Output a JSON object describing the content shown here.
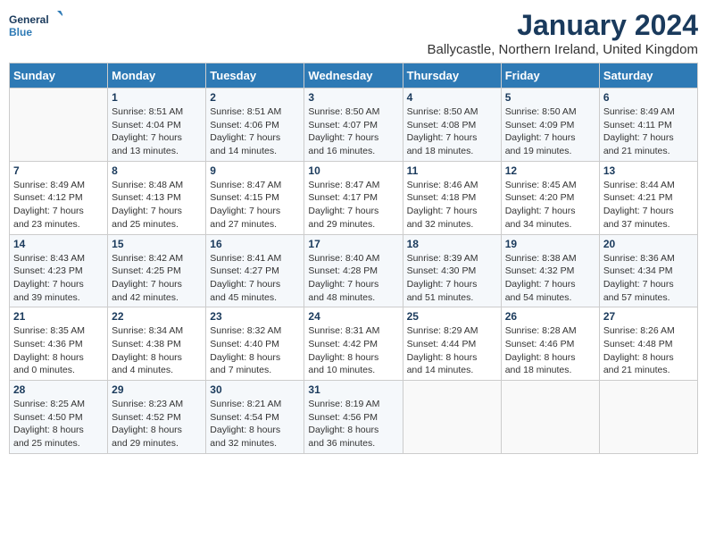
{
  "header": {
    "logo_line1": "General",
    "logo_line2": "Blue",
    "title": "January 2024",
    "subtitle": "Ballycastle, Northern Ireland, United Kingdom"
  },
  "calendar": {
    "days_of_week": [
      "Sunday",
      "Monday",
      "Tuesday",
      "Wednesday",
      "Thursday",
      "Friday",
      "Saturday"
    ],
    "weeks": [
      [
        {
          "day": "",
          "info": ""
        },
        {
          "day": "1",
          "info": "Sunrise: 8:51 AM\nSunset: 4:04 PM\nDaylight: 7 hours\nand 13 minutes."
        },
        {
          "day": "2",
          "info": "Sunrise: 8:51 AM\nSunset: 4:06 PM\nDaylight: 7 hours\nand 14 minutes."
        },
        {
          "day": "3",
          "info": "Sunrise: 8:50 AM\nSunset: 4:07 PM\nDaylight: 7 hours\nand 16 minutes."
        },
        {
          "day": "4",
          "info": "Sunrise: 8:50 AM\nSunset: 4:08 PM\nDaylight: 7 hours\nand 18 minutes."
        },
        {
          "day": "5",
          "info": "Sunrise: 8:50 AM\nSunset: 4:09 PM\nDaylight: 7 hours\nand 19 minutes."
        },
        {
          "day": "6",
          "info": "Sunrise: 8:49 AM\nSunset: 4:11 PM\nDaylight: 7 hours\nand 21 minutes."
        }
      ],
      [
        {
          "day": "7",
          "info": "Sunrise: 8:49 AM\nSunset: 4:12 PM\nDaylight: 7 hours\nand 23 minutes."
        },
        {
          "day": "8",
          "info": "Sunrise: 8:48 AM\nSunset: 4:13 PM\nDaylight: 7 hours\nand 25 minutes."
        },
        {
          "day": "9",
          "info": "Sunrise: 8:47 AM\nSunset: 4:15 PM\nDaylight: 7 hours\nand 27 minutes."
        },
        {
          "day": "10",
          "info": "Sunrise: 8:47 AM\nSunset: 4:17 PM\nDaylight: 7 hours\nand 29 minutes."
        },
        {
          "day": "11",
          "info": "Sunrise: 8:46 AM\nSunset: 4:18 PM\nDaylight: 7 hours\nand 32 minutes."
        },
        {
          "day": "12",
          "info": "Sunrise: 8:45 AM\nSunset: 4:20 PM\nDaylight: 7 hours\nand 34 minutes."
        },
        {
          "day": "13",
          "info": "Sunrise: 8:44 AM\nSunset: 4:21 PM\nDaylight: 7 hours\nand 37 minutes."
        }
      ],
      [
        {
          "day": "14",
          "info": "Sunrise: 8:43 AM\nSunset: 4:23 PM\nDaylight: 7 hours\nand 39 minutes."
        },
        {
          "day": "15",
          "info": "Sunrise: 8:42 AM\nSunset: 4:25 PM\nDaylight: 7 hours\nand 42 minutes."
        },
        {
          "day": "16",
          "info": "Sunrise: 8:41 AM\nSunset: 4:27 PM\nDaylight: 7 hours\nand 45 minutes."
        },
        {
          "day": "17",
          "info": "Sunrise: 8:40 AM\nSunset: 4:28 PM\nDaylight: 7 hours\nand 48 minutes."
        },
        {
          "day": "18",
          "info": "Sunrise: 8:39 AM\nSunset: 4:30 PM\nDaylight: 7 hours\nand 51 minutes."
        },
        {
          "day": "19",
          "info": "Sunrise: 8:38 AM\nSunset: 4:32 PM\nDaylight: 7 hours\nand 54 minutes."
        },
        {
          "day": "20",
          "info": "Sunrise: 8:36 AM\nSunset: 4:34 PM\nDaylight: 7 hours\nand 57 minutes."
        }
      ],
      [
        {
          "day": "21",
          "info": "Sunrise: 8:35 AM\nSunset: 4:36 PM\nDaylight: 8 hours\nand 0 minutes."
        },
        {
          "day": "22",
          "info": "Sunrise: 8:34 AM\nSunset: 4:38 PM\nDaylight: 8 hours\nand 4 minutes."
        },
        {
          "day": "23",
          "info": "Sunrise: 8:32 AM\nSunset: 4:40 PM\nDaylight: 8 hours\nand 7 minutes."
        },
        {
          "day": "24",
          "info": "Sunrise: 8:31 AM\nSunset: 4:42 PM\nDaylight: 8 hours\nand 10 minutes."
        },
        {
          "day": "25",
          "info": "Sunrise: 8:29 AM\nSunset: 4:44 PM\nDaylight: 8 hours\nand 14 minutes."
        },
        {
          "day": "26",
          "info": "Sunrise: 8:28 AM\nSunset: 4:46 PM\nDaylight: 8 hours\nand 18 minutes."
        },
        {
          "day": "27",
          "info": "Sunrise: 8:26 AM\nSunset: 4:48 PM\nDaylight: 8 hours\nand 21 minutes."
        }
      ],
      [
        {
          "day": "28",
          "info": "Sunrise: 8:25 AM\nSunset: 4:50 PM\nDaylight: 8 hours\nand 25 minutes."
        },
        {
          "day": "29",
          "info": "Sunrise: 8:23 AM\nSunset: 4:52 PM\nDaylight: 8 hours\nand 29 minutes."
        },
        {
          "day": "30",
          "info": "Sunrise: 8:21 AM\nSunset: 4:54 PM\nDaylight: 8 hours\nand 32 minutes."
        },
        {
          "day": "31",
          "info": "Sunrise: 8:19 AM\nSunset: 4:56 PM\nDaylight: 8 hours\nand 36 minutes."
        },
        {
          "day": "",
          "info": ""
        },
        {
          "day": "",
          "info": ""
        },
        {
          "day": "",
          "info": ""
        }
      ]
    ]
  }
}
